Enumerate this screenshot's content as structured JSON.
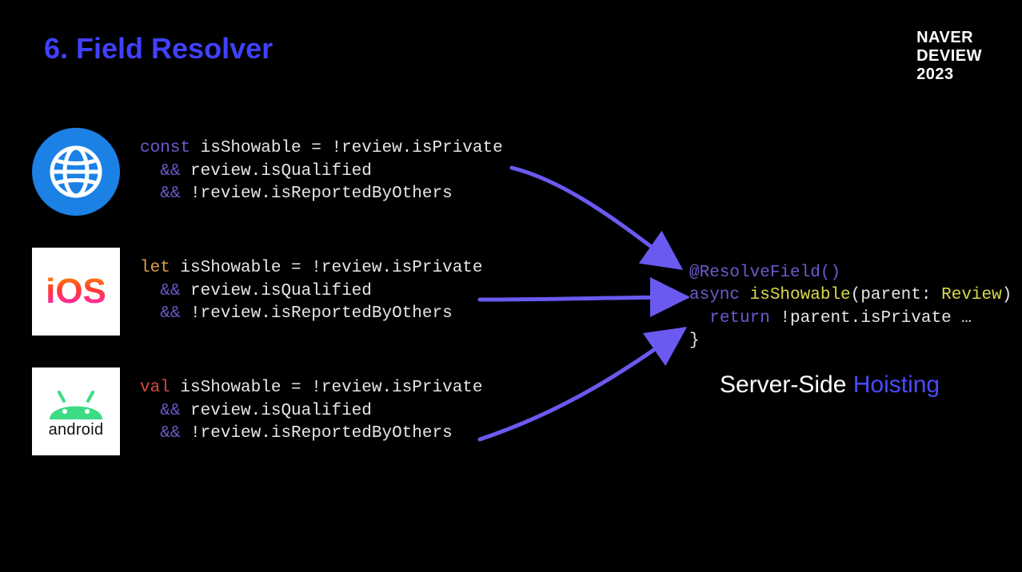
{
  "title": "6. Field Resolver",
  "brand": {
    "line1": "NAVER",
    "line2": "DEVIEW",
    "line3": "2023"
  },
  "platforms": {
    "web": {
      "icon": "globe-icon",
      "code": {
        "kw": "const",
        "name": "isShowable",
        "eq": " = ",
        "l1_rest": "!review.isPrivate",
        "l2_op": "&&",
        "l2_rest": " review.isQualified",
        "l3_op": "&&",
        "l3_rest": " !review.isReportedByOthers"
      }
    },
    "ios": {
      "label": "iOS",
      "code": {
        "kw": "let",
        "name": "isShowable",
        "eq": " = ",
        "l1_rest": "!review.isPrivate",
        "l2_op": "&&",
        "l2_rest": " review.isQualified",
        "l3_op": "&&",
        "l3_rest": " !review.isReportedByOthers"
      }
    },
    "android": {
      "label": "android",
      "code": {
        "kw": "val",
        "name": "isShowable",
        "eq": " = ",
        "l1_rest": "!review.isPrivate",
        "l2_op": "&&",
        "l2_rest": " review.isQualified",
        "l3_op": "&&",
        "l3_rest": " !review.isReportedByOthers"
      }
    }
  },
  "server_code": {
    "decorator": "@ResolveField()",
    "async_kw": "async",
    "func_name": "isShowable",
    "paren_open": "(",
    "param_name": "parent",
    "colon": ": ",
    "param_type": "Review",
    "paren_close_brace": ") {",
    "return_kw": "return",
    "return_rest": " !parent.isPrivate …",
    "close_brace": "}"
  },
  "tagline": {
    "part1": "Server-Side ",
    "part2": "Hoisting"
  },
  "colors": {
    "accent": "#4040ff",
    "arrow": "#6a5af0"
  }
}
